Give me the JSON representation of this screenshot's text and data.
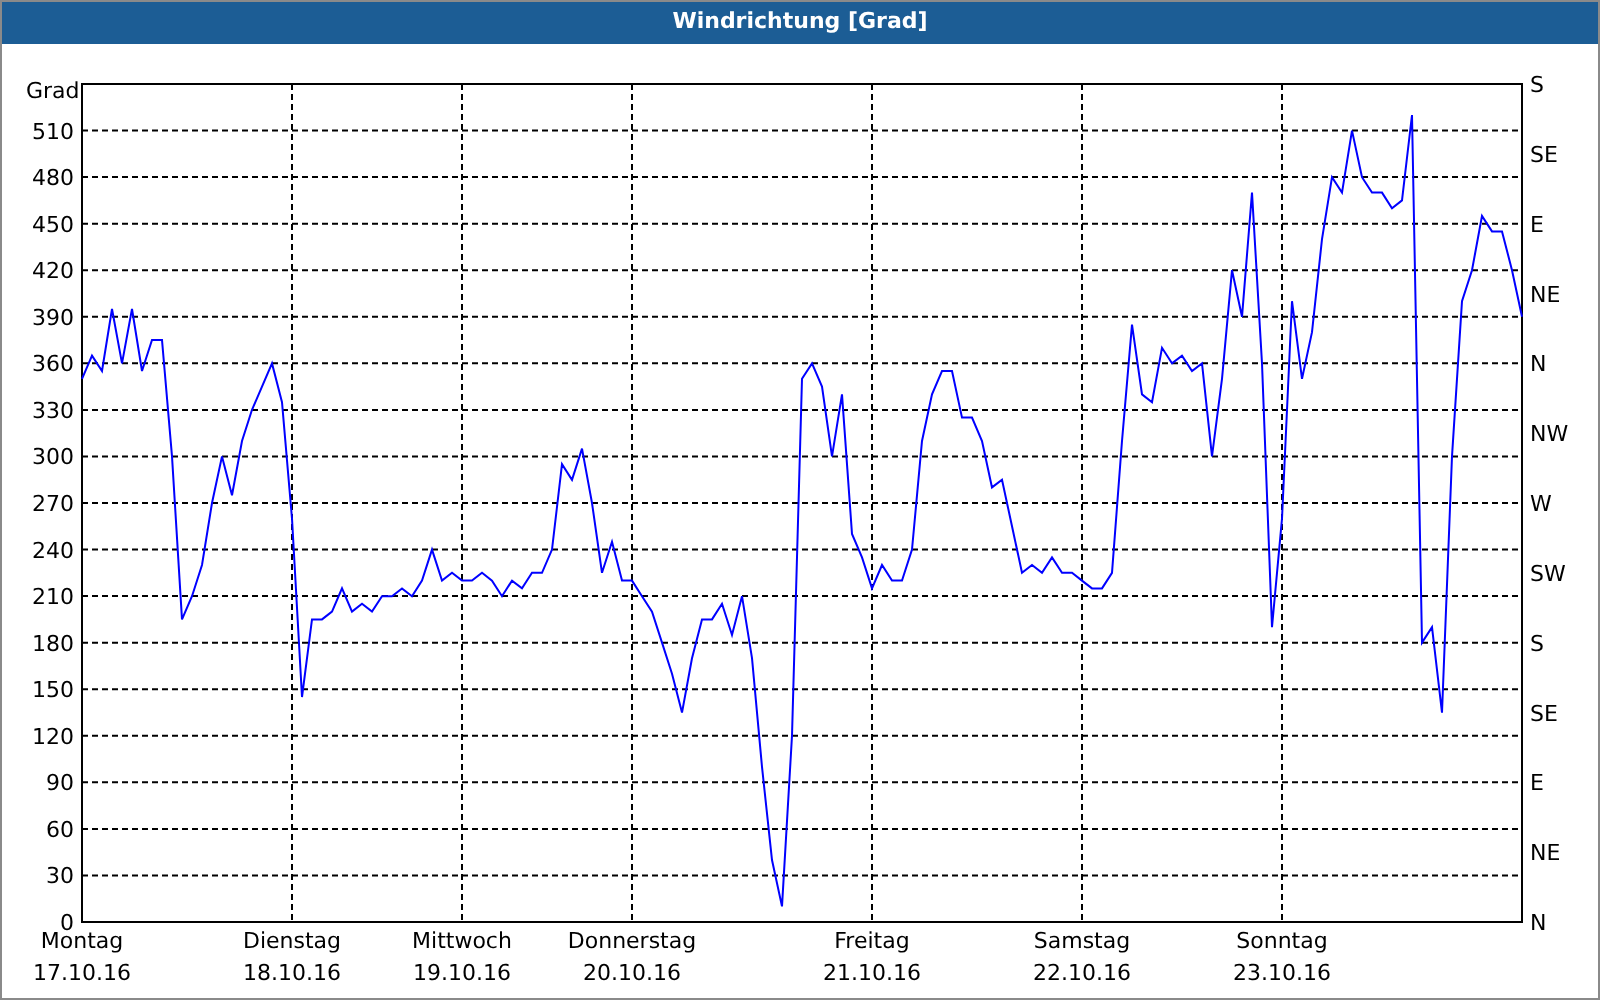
{
  "window": {
    "title": "Windrichtung [Grad]"
  },
  "chart": {
    "chart_data": {
      "type": "line",
      "ylabel": "Grad",
      "grid": true,
      "ylim": [
        0,
        540
      ],
      "yticks": [
        0,
        30,
        60,
        90,
        120,
        150,
        180,
        210,
        240,
        270,
        300,
        330,
        360,
        390,
        420,
        450,
        480,
        510
      ],
      "categories": [
        "Montag 17.10.16",
        null,
        null,
        null,
        null,
        null,
        null,
        null,
        null,
        null,
        null,
        null,
        null,
        null,
        null,
        null,
        null,
        null,
        null,
        null,
        null,
        "Dienstag 18.10.16",
        null,
        null,
        null,
        null,
        null,
        null,
        null,
        null,
        null,
        null,
        null,
        null,
        null,
        null,
        null,
        null,
        "Mittwoch 19.10.16",
        null,
        null,
        null,
        null,
        null,
        null,
        null,
        null,
        null,
        null,
        null,
        null,
        null,
        null,
        null,
        null,
        "Donnerstag 20.10.16",
        null,
        null,
        null,
        null,
        null,
        null,
        null,
        null,
        null,
        null,
        null,
        null,
        null,
        null,
        null,
        null,
        null,
        null,
        null,
        null,
        null,
        null,
        null,
        "Freitag 21.10.16",
        null,
        null,
        null,
        null,
        null,
        null,
        null,
        null,
        null,
        null,
        null,
        null,
        null,
        null,
        null,
        null,
        null,
        null,
        null,
        null,
        "Samstag 22.10.16",
        null,
        null,
        null,
        null,
        null,
        null,
        null,
        null,
        null,
        null,
        null,
        null,
        null,
        null,
        null,
        null,
        null,
        null,
        null,
        "Sonntag 23.10.16",
        null,
        null,
        null,
        null,
        null,
        null,
        null,
        null,
        null,
        null,
        null,
        null,
        null,
        null,
        null,
        null,
        null,
        null,
        null,
        null,
        null,
        null,
        null,
        null
      ],
      "series": [
        {
          "color": "#0000ff",
          "values": [
            350,
            365,
            355,
            395,
            360,
            395,
            355,
            375,
            375,
            300,
            195,
            210,
            230,
            270,
            300,
            275,
            310,
            330,
            345,
            360,
            335,
            260,
            145,
            195,
            195,
            200,
            215,
            200,
            205,
            200,
            210,
            210,
            215,
            210,
            220,
            240,
            220,
            225,
            220,
            220,
            225,
            220,
            210,
            220,
            215,
            225,
            225,
            240,
            295,
            285,
            305,
            270,
            225,
            245,
            220,
            220,
            210,
            200,
            180,
            160,
            135,
            170,
            195,
            195,
            205,
            185,
            210,
            170,
            100,
            40,
            10,
            120,
            350,
            360,
            345,
            300,
            340,
            250,
            235,
            215,
            230,
            220,
            220,
            240,
            310,
            340,
            355,
            355,
            325,
            325,
            310,
            280,
            285,
            255,
            225,
            230,
            225,
            235,
            225,
            225,
            220,
            215,
            215,
            225,
            310,
            385,
            340,
            335,
            370,
            360,
            365,
            355,
            360,
            300,
            350,
            420,
            390,
            470,
            360,
            190,
            260,
            400,
            350,
            380,
            440,
            480,
            470,
            510,
            480,
            470,
            470,
            460,
            465,
            520,
            180,
            190,
            135,
            300,
            400,
            420,
            455,
            445,
            445,
            420,
            390
          ]
        }
      ]
    },
    "right_axis": {
      "labels": [
        "S",
        "SE",
        "E",
        "NE",
        "N",
        "NW",
        "W",
        "SW",
        "S",
        "SE",
        "E",
        "NE",
        "N"
      ]
    }
  }
}
